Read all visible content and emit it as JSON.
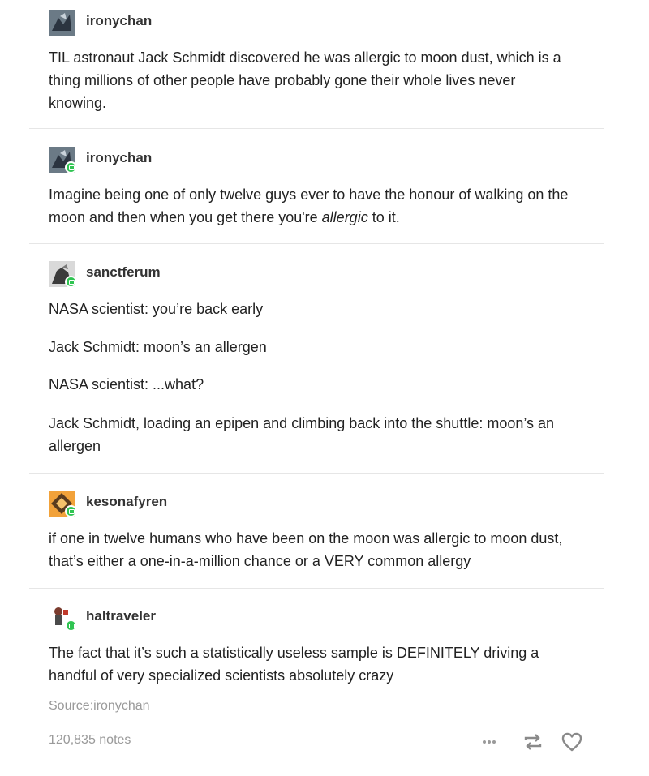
{
  "posts": [
    {
      "username": "ironychan",
      "reblog": false,
      "lines": [
        "TIL astronaut Jack Schmidt discovered he was allergic to moon dust, which is a",
        "thing millions of other people have probably gone their whole lives never",
        "knowing."
      ]
    },
    {
      "username": "ironychan",
      "reblog": true,
      "lines": [
        "Imagine being one of only twelve guys ever to have the honour of walking on the",
        "moon and then when you get there you're "
      ],
      "emphasis": "allergic",
      "tail": " to it."
    },
    {
      "username": "sanctferum",
      "reblog": true,
      "paragraphs": [
        "NASA scientist: you’re back early",
        "Jack Schmidt: moon’s an allergen",
        "NASA scientist: ...what?",
        "Jack Schmidt, loading an epipen and climbing back into the shuttle: moon’s an",
        "allergen"
      ]
    },
    {
      "username": "kesonafyren",
      "reblog": true,
      "lines": [
        "if one in twelve humans who have been on the moon was allergic to moon dust,",
        "that’s either a one-in-a-million chance or a VERY common allergy"
      ]
    },
    {
      "username": "haltraveler",
      "reblog": true,
      "lines": [
        "The fact that it’s such a statistically useless sample is DEFINITELY driving a",
        "handful of very specialized scientists absolutely crazy"
      ]
    }
  ],
  "footer": {
    "source": "Source:ironychan",
    "notes": "120,835 notes"
  },
  "icons": {
    "more": "more-options-icon",
    "reblog": "reblog-icon",
    "like": "heart-icon"
  },
  "colors": {
    "reblog_badge": "#30c452",
    "muted_text": "#9a9a9a",
    "divider": "#e6e6e6"
  }
}
